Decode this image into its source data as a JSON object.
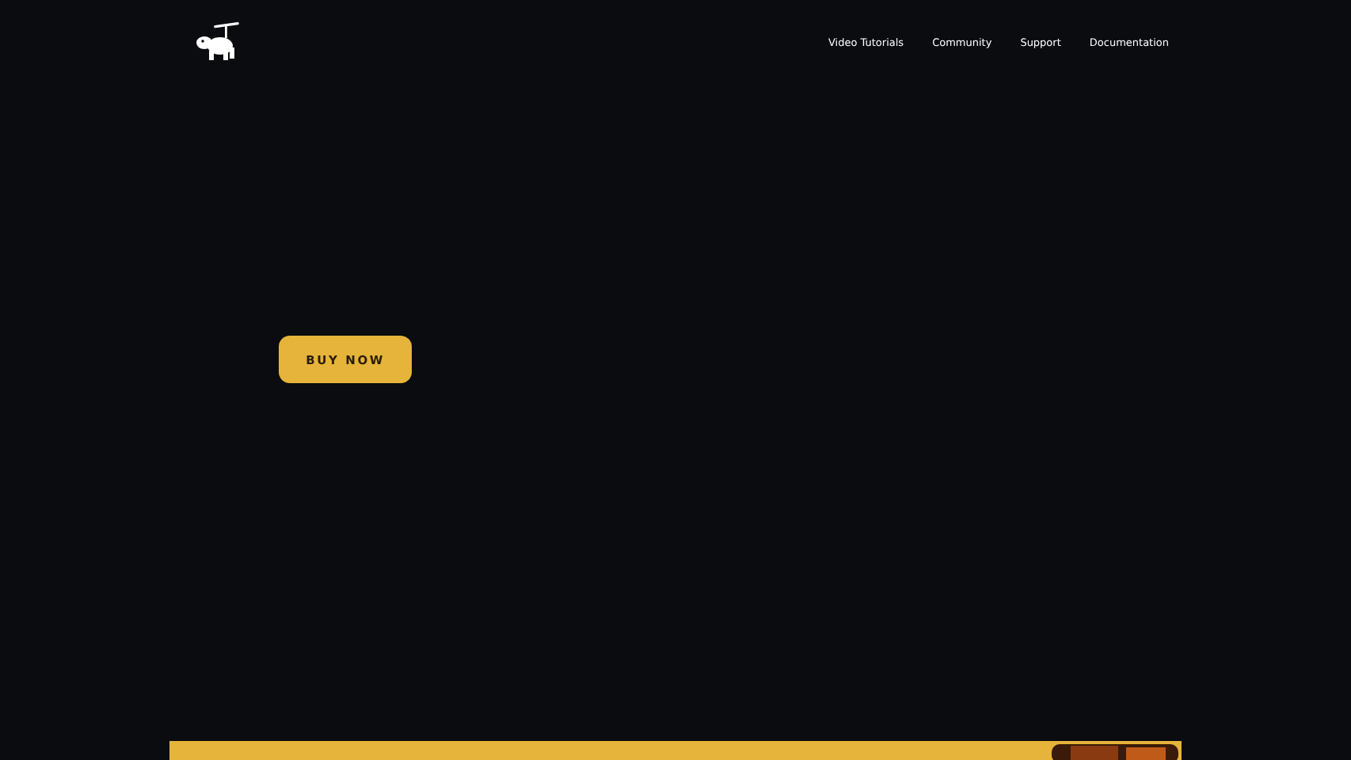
{
  "nav": {
    "links": [
      "Video Tutorials",
      "Community",
      "Support",
      "Documentation"
    ]
  },
  "hero": {
    "button": "BUY NOW"
  }
}
